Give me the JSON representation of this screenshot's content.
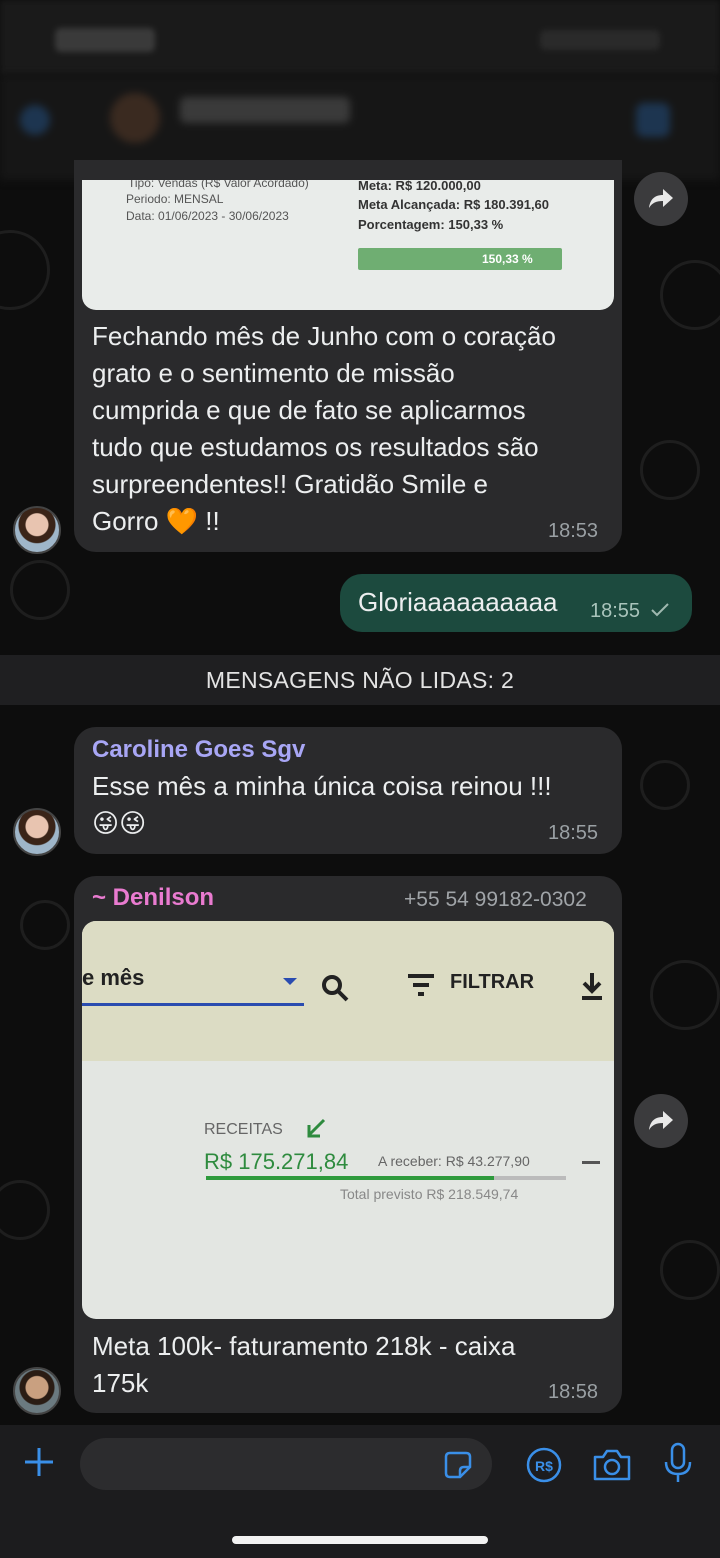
{
  "colors": {
    "incoming_bubble": "#2a2a2c",
    "outgoing_bubble": "#1c4a3e",
    "accent": "#3a8fe8",
    "caroline_name": "#a8a6f5",
    "denilson_name": "#e97bd0"
  },
  "msg1": {
    "image": {
      "tipo": "Tipo: Vendas (R$ Valor Acordado)",
      "periodo": "Periodo: MENSAL",
      "data": "Data: 01/06/2023 - 30/06/2023",
      "meta": "Meta: R$ 120.000,00",
      "meta_alcancada": "Meta Alcançada: R$ 180.391,60",
      "porcentagem": "Porcentagem: 150,33 %",
      "bar_label": "150,33 %"
    },
    "lines": [
      "Fechando mês de Junho com o coração",
      "grato e o sentimento de missão",
      "cumprida e que de fato se aplicarmos",
      "tudo que estudamos os resultados são",
      "surpreendentes!! Gratidão Smile e",
      "Gorro 🧡 !!"
    ],
    "time": "18:53"
  },
  "msg2": {
    "text": "Gloriaaaaaaaaaa",
    "time": "18:55",
    "status_icon": "check-icon"
  },
  "unread_banner": "MENSAGENS NÃO LIDAS: 2",
  "msg3": {
    "sender": "Caroline Goes Sgv",
    "lines": [
      "Esse mês a minha única coisa reinou !!!",
      "😜😜"
    ],
    "time": "18:55"
  },
  "msg4": {
    "sender": "~ Denilson",
    "phone": "+55 54 99182-0302",
    "image": {
      "mes": "e mês",
      "filtrar": "FILTRAR",
      "receitas": "RECEITAS",
      "valor": "R$  175.271,84",
      "a_receber": "A receber: R$  43.277,90",
      "total_previsto": "Total previsto R$  218.549,74",
      "progress": 0.8
    },
    "lines": [
      "Meta 100k- faturamento 218k - caixa",
      "175k"
    ],
    "time": "18:58"
  }
}
